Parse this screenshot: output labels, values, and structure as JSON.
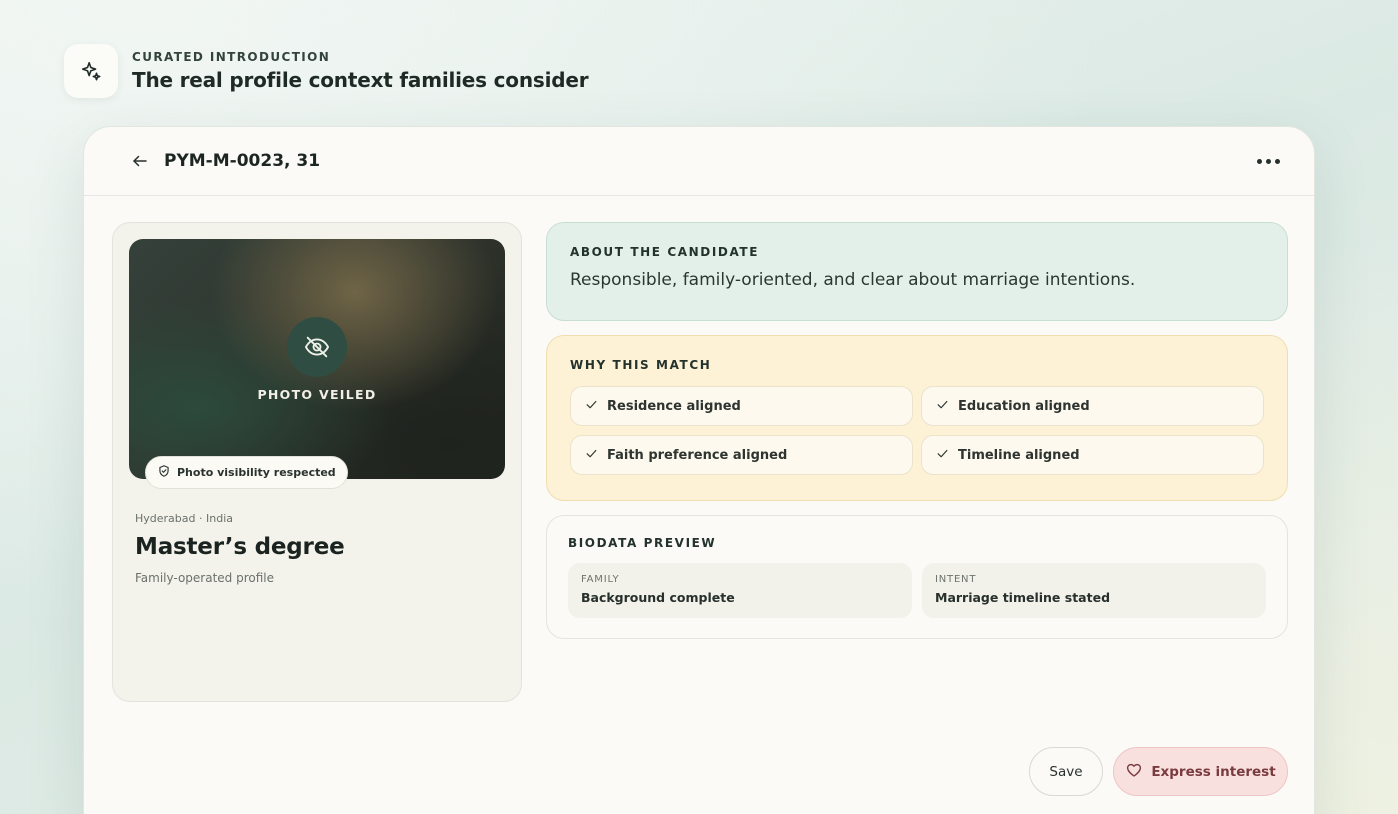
{
  "intro": {
    "icon": "sparkle-icon",
    "eyebrow": "CURATED INTRODUCTION",
    "title": "The real profile context families consider"
  },
  "header": {
    "back_icon": "arrow-left-icon",
    "profile_title": "PYM-M-0023, 31",
    "more_icon": "more-horizontal-icon"
  },
  "profile": {
    "photo": {
      "icon": "eye-off-icon",
      "label": "PHOTO VEILED",
      "visibility_chip": "Photo visibility respected",
      "chip_icon": "shield-check-icon"
    },
    "location": "Hyderabad · India",
    "degree": "Master’s degree",
    "operated_by": "Family-operated profile"
  },
  "about": {
    "eyebrow": "ABOUT THE CANDIDATE",
    "text": "Responsible, family-oriented, and clear about marriage intentions."
  },
  "why_match": {
    "eyebrow": "WHY THIS MATCH",
    "check_icon": "check-icon",
    "items": [
      "Residence aligned",
      "Education aligned",
      "Faith preference aligned",
      "Timeline aligned"
    ]
  },
  "biodata": {
    "eyebrow": "BIODATA PREVIEW",
    "cells": [
      {
        "label": "FAMILY",
        "value": "Background complete"
      },
      {
        "label": "INTENT",
        "value": "Marriage timeline stated"
      }
    ]
  },
  "actions": {
    "save_label": "Save",
    "interest_label": "Express interest",
    "interest_icon": "heart-icon"
  },
  "colors": {
    "accent_green": "#2f4d42",
    "about_bg": "#e3f0e9",
    "why_bg": "#fdf2d6",
    "interest_bg": "#f8e0df",
    "interest_text": "#7a3b3e"
  }
}
